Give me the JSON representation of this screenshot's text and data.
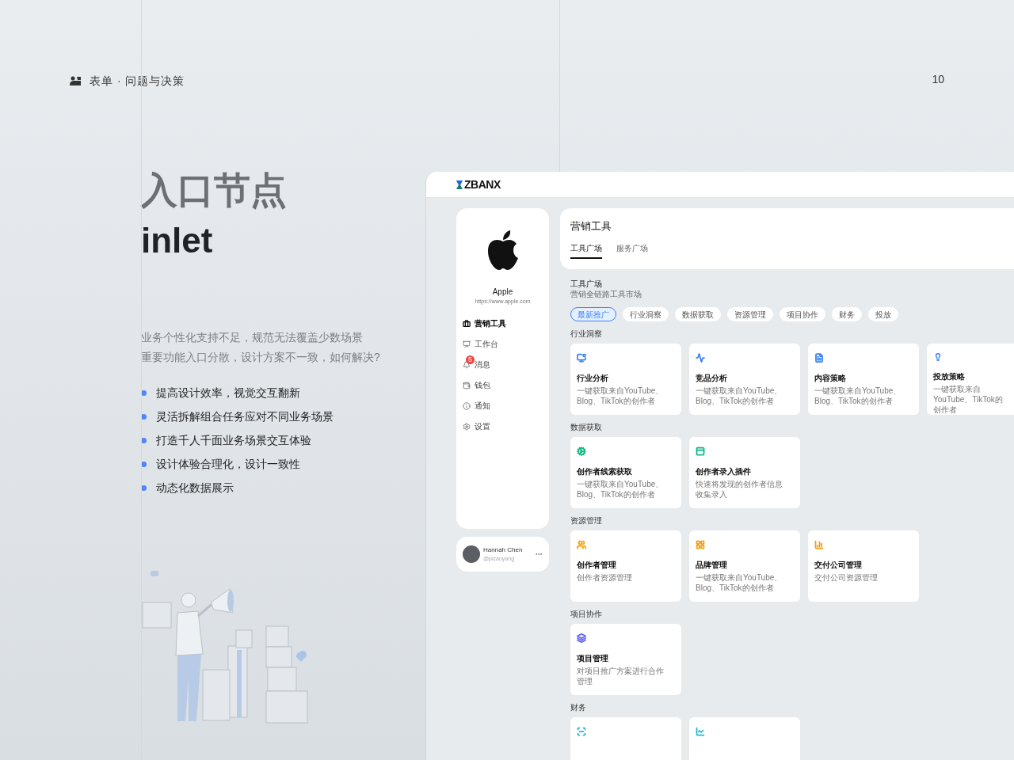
{
  "header": {
    "text": "表单 · 问题与决策",
    "page_number": "10"
  },
  "heading": {
    "title": "入口节点",
    "subtitle": "inlet"
  },
  "problems": [
    "业务个性化支持不足，规范无法覆盖少数场景",
    "重要功能入口分散，设计方案不一致，如何解决?"
  ],
  "goals": [
    "提高设计效率，视觉交互翻新",
    "灵活拆解组合任务应对不同业务场景",
    "打造千人千面业务场景交互体验",
    "设计体验合理化，设计一致性",
    "动态化数据展示"
  ],
  "app": {
    "logo": "ZBANX",
    "brand": {
      "name": "Apple",
      "url": "https://www.apple.com"
    },
    "nav": [
      {
        "label": "营销工具",
        "selected": true
      },
      {
        "label": "工作台",
        "selected": false
      },
      {
        "label": "消息",
        "selected": false,
        "badge": "5"
      },
      {
        "label": "钱包",
        "selected": false
      },
      {
        "label": "通知",
        "selected": false
      },
      {
        "label": "设置",
        "selected": false
      }
    ],
    "user": {
      "name": "Hannah Chen",
      "handle": "@pizaoyang"
    },
    "page_title": "营销工具",
    "tabs": [
      {
        "label": "工具广场",
        "selected": true
      },
      {
        "label": "服务广场",
        "selected": false
      }
    ],
    "section": {
      "title": "工具广场",
      "subtitle": "营销全链路工具市场"
    },
    "filters": [
      {
        "label": "最新推广",
        "selected": true
      },
      {
        "label": "行业洞察",
        "selected": false
      },
      {
        "label": "数据获取",
        "selected": false
      },
      {
        "label": "资源管理",
        "selected": false
      },
      {
        "label": "项目协作",
        "selected": false
      },
      {
        "label": "财务",
        "selected": false
      },
      {
        "label": "投放",
        "selected": false
      }
    ],
    "groups": [
      {
        "title": "行业洞察",
        "color": "#3b82f6",
        "tools": [
          {
            "kind": "card",
            "title": "行业分析",
            "description": "一键获取来自YouTube、Blog、TikTok的创作者"
          },
          {
            "kind": "card",
            "title": "竞品分析",
            "description": "一键获取来自YouTube、Blog、TikTok的创作者"
          },
          {
            "kind": "card",
            "title": "内容策略",
            "description": "一键获取来自YouTube、Blog、TikTok的创作者"
          },
          {
            "kind": "card",
            "title": "投放策略",
            "description": "一键获取来自YouTube、TikTok的创作者"
          }
        ]
      },
      {
        "title": "数据获取",
        "color": "#10b981",
        "tools": [
          {
            "kind": "card",
            "title": "创作者线索获取",
            "description": "一键获取来自YouTube、Blog、TikTok的创作者"
          },
          {
            "kind": "card",
            "title": "创作者录入插件",
            "description": "快速将发现的创作者信息收集录入"
          }
        ]
      },
      {
        "title": "资源管理",
        "color": "#f59e0b",
        "tools": [
          {
            "kind": "card",
            "title": "创作者管理",
            "description": "创作者资源管理"
          },
          {
            "kind": "card",
            "title": "品牌管理",
            "description": "一键获取来自YouTube、Blog、TikTok的创作者"
          },
          {
            "kind": "card",
            "title": "交付公司管理",
            "description": "交付公司资源管理"
          }
        ]
      },
      {
        "title": "项目协作",
        "color": "#6366f1",
        "tools": [
          {
            "kind": "card",
            "title": "项目管理",
            "description": "对项目推广方案进行合作管理"
          }
        ]
      },
      {
        "title": "财务",
        "color": "#22b8cf",
        "tools": [
          {
            "kind": "cut"
          },
          {
            "kind": "cut"
          }
        ]
      }
    ]
  }
}
